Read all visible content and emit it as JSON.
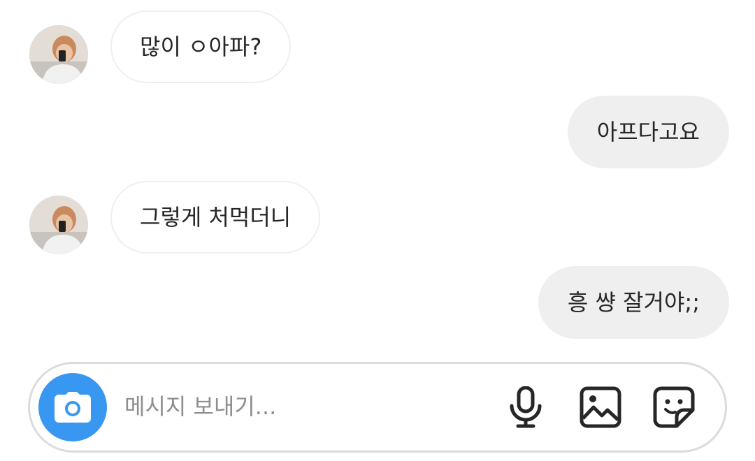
{
  "messages": [
    {
      "side": "in",
      "text": "많이 ㅇ아파?"
    },
    {
      "side": "out",
      "text": "아프다고요"
    },
    {
      "side": "in",
      "text": "그렇게 처먹더니"
    },
    {
      "side": "out",
      "text": "흥 썅 잘거야;;"
    }
  ],
  "composer": {
    "placeholder": "메시지 보내기..."
  },
  "icons": {
    "camera": "camera-icon",
    "microphone": "microphone-icon",
    "gallery": "image-icon",
    "sticker": "sticker-icon"
  },
  "colors": {
    "camera_button": "#3897f0",
    "outgoing_bubble": "#efefef",
    "incoming_border": "#efefef"
  }
}
